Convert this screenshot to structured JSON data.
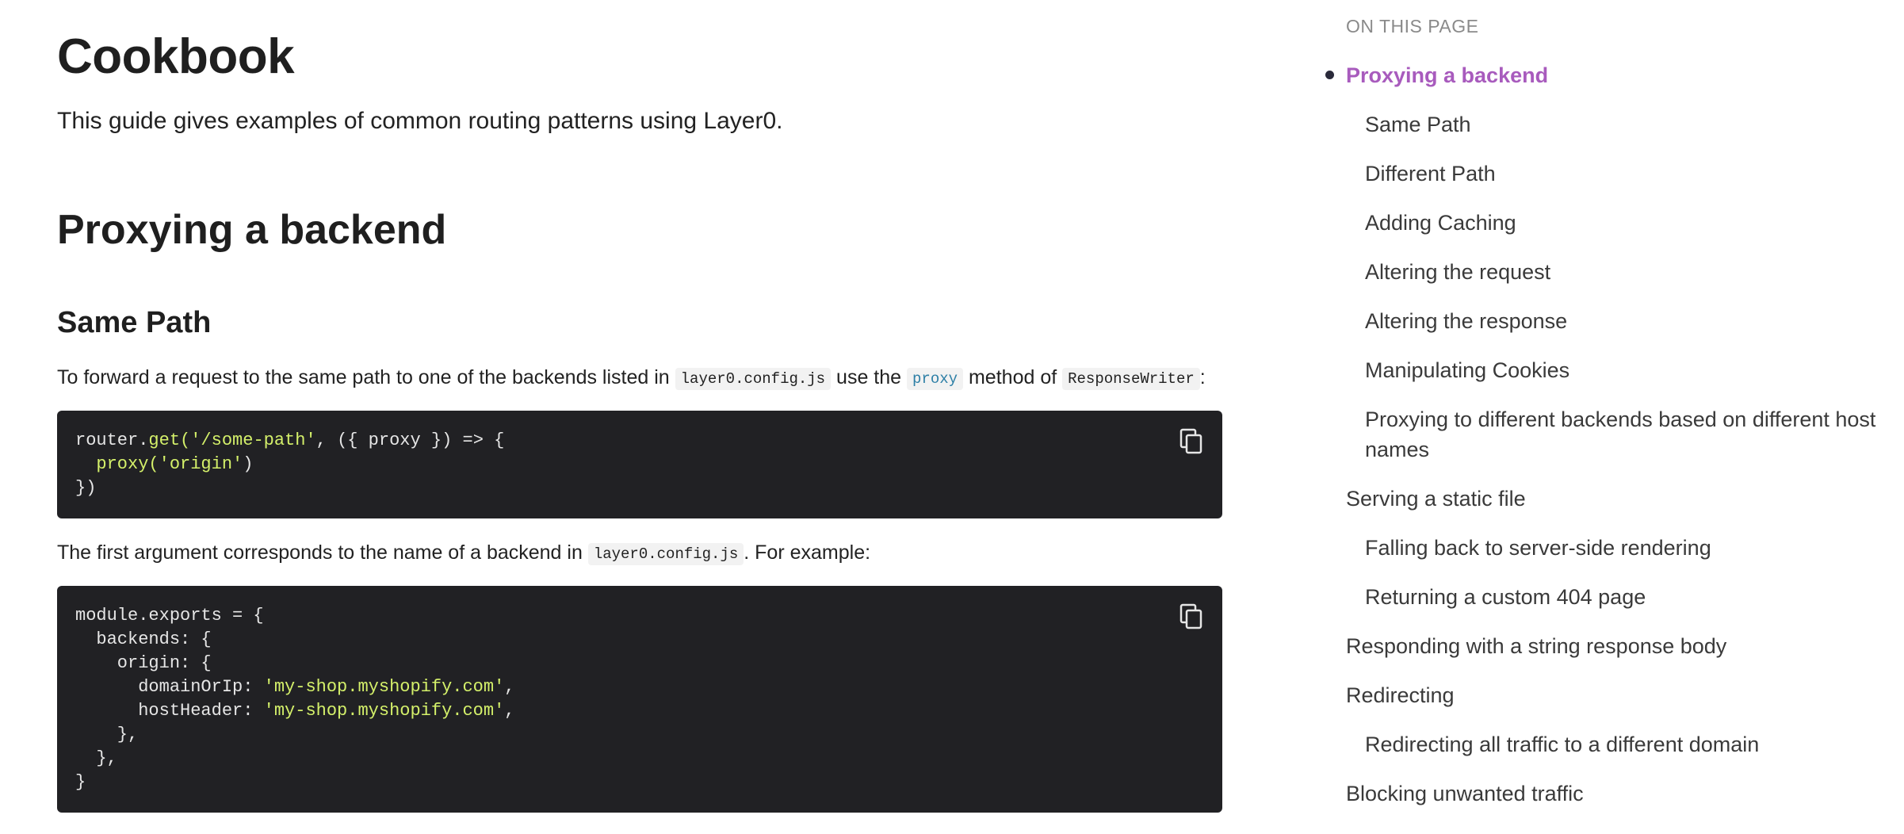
{
  "main": {
    "title": "Cookbook",
    "intro": "This guide gives examples of common routing patterns using Layer0.",
    "section_heading": "Proxying a backend",
    "subsection_heading": "Same Path",
    "para1": {
      "before": "To forward a request to the same path to one of the backends listed in",
      "code1": "layer0.config.js",
      "middle1": "use the",
      "code2": "proxy",
      "middle2": "method of",
      "code3": "ResponseWriter",
      "after": ":"
    },
    "code_block_1": {
      "lines": [
        [
          "router.",
          "get(",
          "'/some-path'",
          ", ({ proxy }) => {"
        ],
        [
          "  ",
          "proxy(",
          "'origin'",
          ")"
        ],
        [
          "})"
        ]
      ]
    },
    "para2": {
      "before": "The first argument corresponds to the name of a backend in",
      "code1": "layer0.config.js",
      "after": ". For example:"
    },
    "code_block_2": {
      "line1": "module.exports = {",
      "line2": "  backends: {",
      "line3": "    origin: {",
      "line4_key": "      domainOrIp: ",
      "line4_val": "'my-shop.myshopify.com'",
      "line4_end": ",",
      "line5_key": "      hostHeader: ",
      "line5_val": "'my-shop.myshopify.com'",
      "line5_end": ",",
      "line6": "    },",
      "line7": "  },",
      "line8": "}"
    },
    "copy_icon": "copy-icon"
  },
  "toc": {
    "title": "ON THIS PAGE",
    "items": [
      {
        "label": "Proxying a backend",
        "level": 1,
        "active": true
      },
      {
        "label": "Same Path",
        "level": 2
      },
      {
        "label": "Different Path",
        "level": 2
      },
      {
        "label": "Adding Caching",
        "level": 2
      },
      {
        "label": "Altering the request",
        "level": 2
      },
      {
        "label": "Altering the response",
        "level": 2
      },
      {
        "label": "Manipulating Cookies",
        "level": 2
      },
      {
        "label": "Proxying to different backends based on different host",
        "level": 2
      },
      {
        "label": "names",
        "level": 2
      },
      {
        "label": "Serving a static file",
        "level": 1
      },
      {
        "label": "Falling back to server-side rendering",
        "level": 2
      },
      {
        "label": "Returning a custom 404 page",
        "level": 2
      },
      {
        "label": "Responding with a string response body",
        "level": 1
      },
      {
        "label": "Redirecting",
        "level": 1
      },
      {
        "label": "Redirecting all traffic to a different domain",
        "level": 2
      },
      {
        "label": "Blocking unwanted traffic",
        "level": 1
      }
    ],
    "active_color": "#a85bbd"
  }
}
